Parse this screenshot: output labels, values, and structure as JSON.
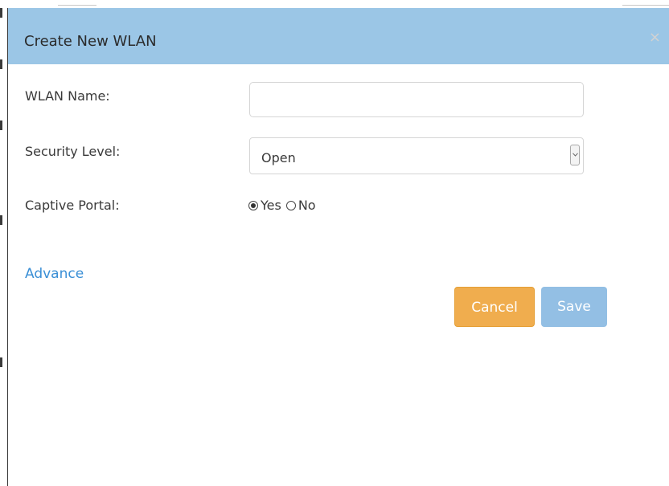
{
  "modal": {
    "title": "Create New WLAN",
    "close_glyph": "×"
  },
  "form": {
    "wlan_name": {
      "label": "WLAN Name:",
      "value": "",
      "placeholder": ""
    },
    "security_level": {
      "label": "Security Level:",
      "selected": "Open"
    },
    "captive_portal": {
      "label": "Captive Portal:",
      "options": [
        {
          "label": "Yes",
          "checked": true
        },
        {
          "label": "No",
          "checked": false
        }
      ]
    }
  },
  "advance_link": "Advance",
  "buttons": {
    "cancel": "Cancel",
    "save": "Save"
  },
  "colors": {
    "header_bg": "#9bc6e6",
    "cancel_bg": "#f0ad4e",
    "save_bg": "#93bfe4",
    "link": "#3a8fd6"
  }
}
